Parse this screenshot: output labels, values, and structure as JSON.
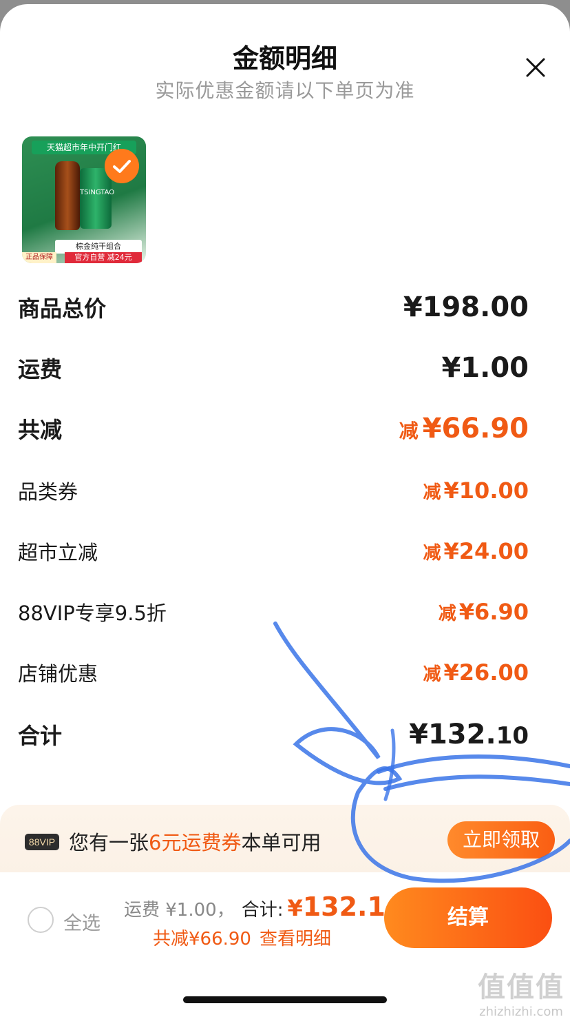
{
  "header": {
    "title": "金额明细",
    "subtitle": "实际优惠金额请以下单页为准"
  },
  "product": {
    "banner": "天猫超市年中开门红",
    "can_brand": "TSINGTAO",
    "combo_name": "棕金纯干组合",
    "promo_strip": "官方自营 减24元",
    "guarantee": "正品保障",
    "selected": true
  },
  "breakdown": {
    "goods_total": {
      "label": "商品总价",
      "amount": "¥198.00"
    },
    "shipping": {
      "label": "运费",
      "amount": "¥1.00"
    },
    "total_discount": {
      "label": "共减",
      "prefix": "减",
      "amount": "¥66.90"
    },
    "category_coupon": {
      "label": "品类券",
      "prefix": "减",
      "amount": "¥10.00"
    },
    "market_discount": {
      "label": "超市立减",
      "prefix": "减",
      "amount": "¥24.00"
    },
    "vip_discount": {
      "label": "88VIP专享9.5折",
      "prefix": "减",
      "amount": "¥6.90"
    },
    "store_discount": {
      "label": "店铺优惠",
      "prefix": "减",
      "amount": "¥26.00"
    },
    "total": {
      "label": "合计",
      "amount_main": "¥132.",
      "amount_dec": "10"
    }
  },
  "promo": {
    "vip_badge": "88VIP",
    "text_before": "您有一张",
    "text_highlight": "6元运费券",
    "text_after": "本单可用",
    "button": "立即领取"
  },
  "checkout": {
    "select_all": "全选",
    "shipping_text": "运费 ¥1.00，",
    "total_label": "合计:",
    "total_yen": "¥",
    "total_value": "132.1",
    "discount_text": "共减¥66.90",
    "detail_link": "查看明细",
    "button": "结算"
  },
  "watermark": {
    "logo": "值值值",
    "site": "zhizhizhi.com"
  },
  "colors": {
    "accent": "#f05a14",
    "button_gradient_start": "#ff8a1e",
    "button_gradient_end": "#fb4f12",
    "scribble": "#3a74e8"
  }
}
